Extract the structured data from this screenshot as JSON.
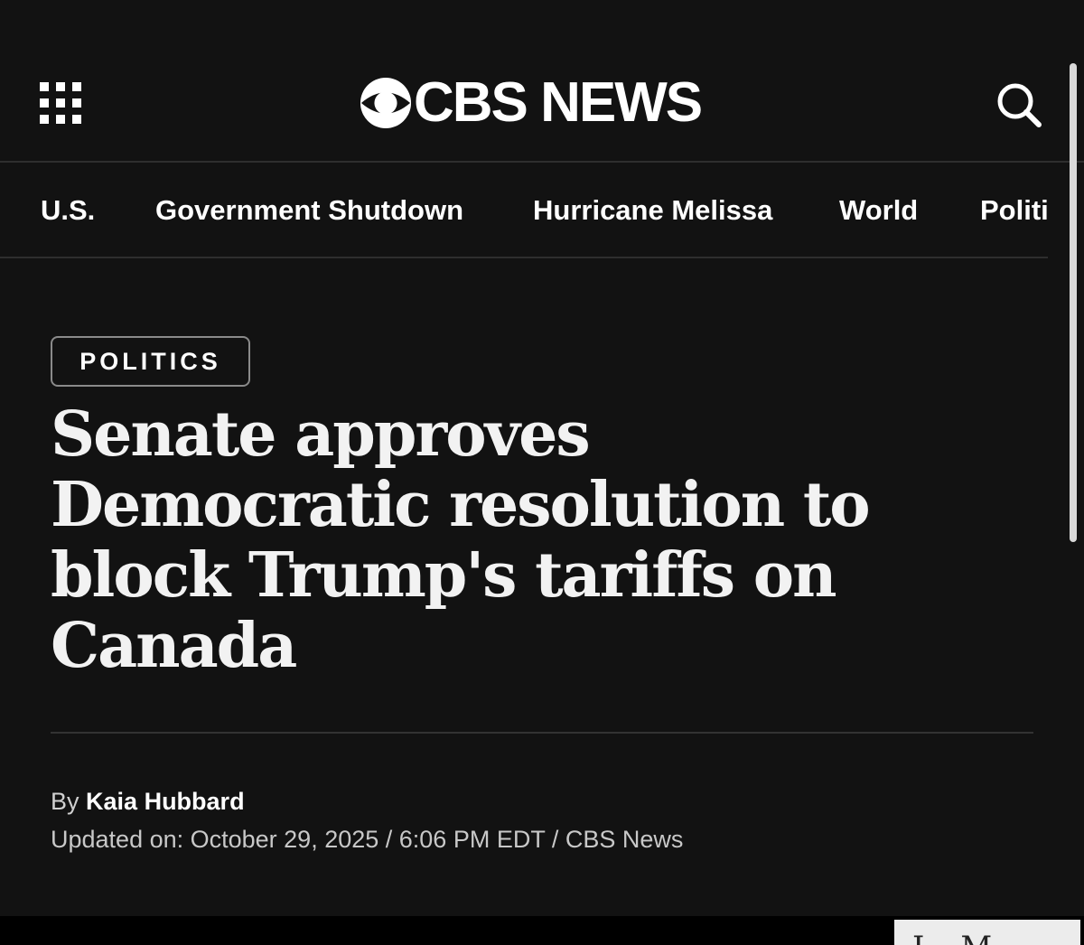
{
  "header": {
    "logo_text": "CBS NEWS",
    "menu_icon": "grid-menu-icon",
    "search_icon": "search-icon"
  },
  "nav": {
    "items": [
      {
        "label": "U.S."
      },
      {
        "label": "Government Shutdown"
      },
      {
        "label": "Hurricane Melissa"
      },
      {
        "label": "World"
      },
      {
        "label": "Politi"
      }
    ]
  },
  "article": {
    "category": "POLITICS",
    "headline": "Senate approves Democratic resolution to block Trump's tariffs on Canada",
    "byline_prefix": "By",
    "author": "Kaia Hubbard",
    "updated": "Updated on: October 29, 2025 / 6:06 PM EDT / CBS News"
  },
  "bottom_card": {
    "partial_text": "L M"
  },
  "colors": {
    "background": "#121212",
    "text": "#ffffff",
    "divider": "#333333"
  }
}
